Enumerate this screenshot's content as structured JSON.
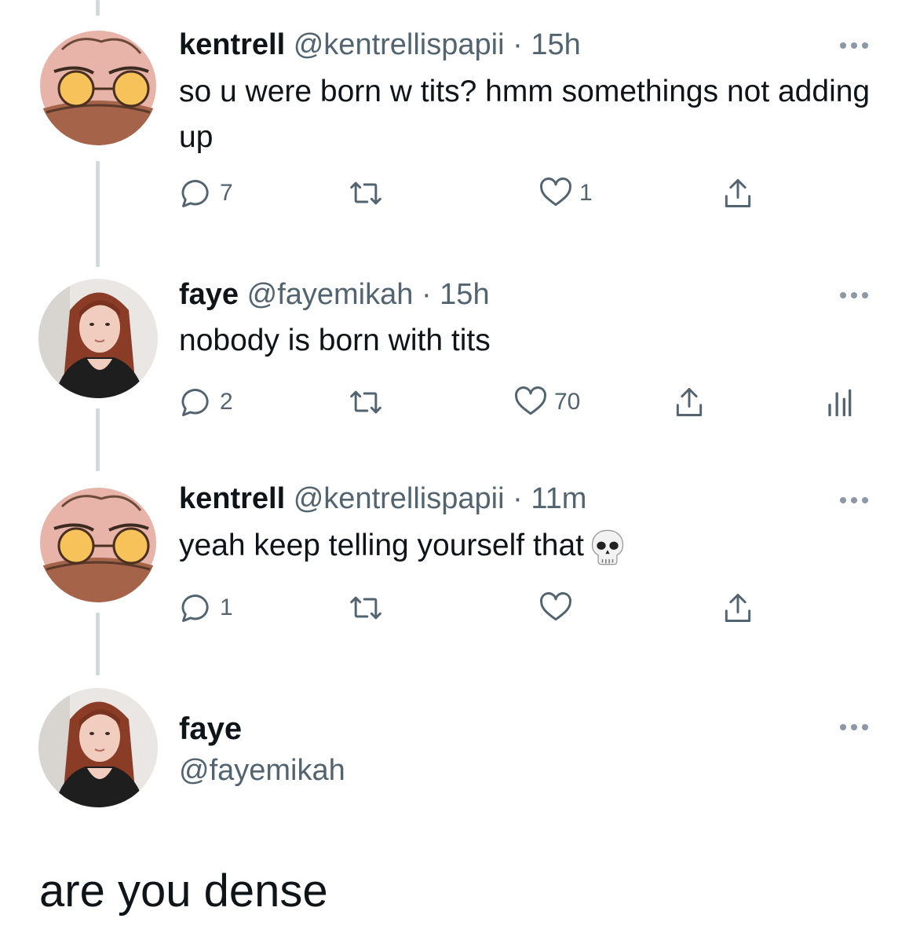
{
  "tweets": [
    {
      "name": "kentrell",
      "handle": "@kentrellispapii",
      "separator": "·",
      "time": "15h",
      "text": "so u were born w tits? hmm somethings not adding up",
      "reply_count": "7",
      "like_count": "1",
      "avatar_icon": "cartoon-frog-avatar"
    },
    {
      "name": "faye",
      "handle": "@fayemikah",
      "separator": "·",
      "time": "15h",
      "text": "nobody is born with tits",
      "reply_count": "2",
      "like_count": "70",
      "avatar_icon": "profile-photo-avatar"
    },
    {
      "name": "kentrell",
      "handle": "@kentrellispapii",
      "separator": "·",
      "time": "11m",
      "text": "yeah keep telling yourself that",
      "emoji": "skull-emoji",
      "reply_count": "1",
      "avatar_icon": "cartoon-frog-avatar"
    }
  ],
  "focused": {
    "name": "faye",
    "handle": "@fayemikah",
    "text": "are you dense",
    "avatar_icon": "profile-photo-avatar"
  },
  "colors": {
    "text": "#0f1419",
    "secondary": "#536471",
    "thread_line": "#cfd9de",
    "icon": "#536471"
  }
}
